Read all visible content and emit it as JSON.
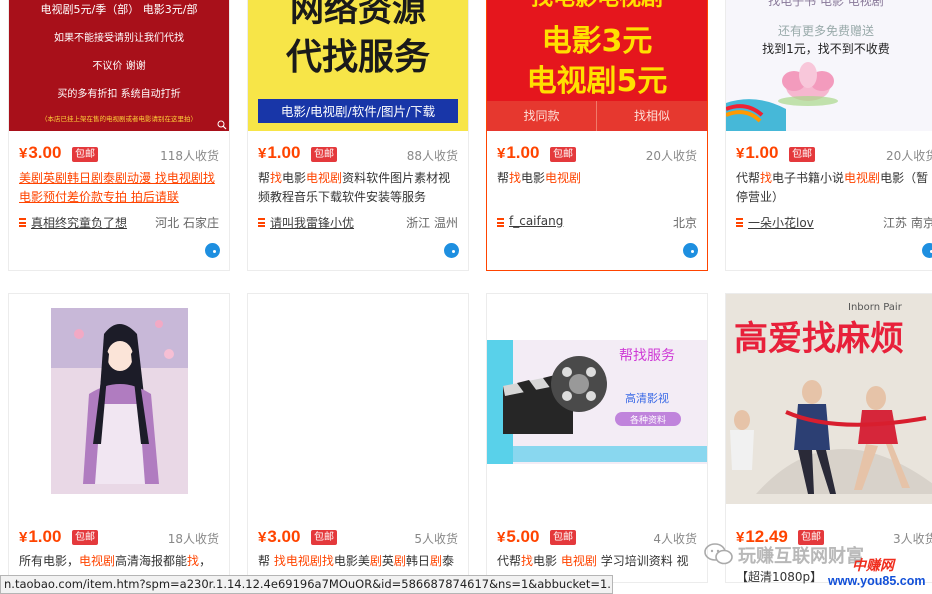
{
  "products": [
    {
      "price": "3.00",
      "tag": "包邮",
      "sold": "118人收货",
      "title": "美剧英剧韩日剧泰剧动漫 找电视剧找电影预付差价款专拍 拍后请联",
      "shop": "真相终究童负了想",
      "location": "河北 石家庄",
      "image": {
        "lines": [
          "电视剧5元/季（部） 电影3元/部",
          "如果不能接受请别让我们代找",
          "不议价 谢谢",
          "买的多有折扣 系统自动打折",
          "（本店已挂上架在售的电视剧或者电影请别在这里拍）"
        ]
      }
    },
    {
      "price": "1.00",
      "tag": "包邮",
      "sold": "88人收货",
      "title_segments": [
        {
          "t": "帮",
          "kw": false
        },
        {
          "t": "找",
          "kw": true
        },
        {
          "t": "电影",
          "kw": false
        },
        {
          "t": "电视剧",
          "kw": true
        },
        {
          "t": "资料软件图片素材视频教程音乐下载软件安装等服务",
          "kw": false
        }
      ],
      "shop": "请叫我雷锋小优",
      "location": "浙江 温州",
      "image": {
        "line1": "网络资源",
        "line2": "代找服务",
        "line3": "电影/电视剧/软件/图片/下载"
      }
    },
    {
      "price": "1.00",
      "tag": "包邮",
      "sold": "20人收货",
      "title_segments": [
        {
          "t": "帮",
          "kw": false
        },
        {
          "t": "找",
          "kw": true
        },
        {
          "t": "电影",
          "kw": false
        },
        {
          "t": "电视剧",
          "kw": true
        }
      ],
      "shop": "f_caifang",
      "location": "北京",
      "image": {
        "top": "找电影电视剧",
        "line1": "电影3元",
        "line2": "电视剧5元"
      },
      "buttons": [
        "找同款",
        "找相似"
      ]
    },
    {
      "price": "1.00",
      "tag": "包邮",
      "sold": "20人收货",
      "title_segments": [
        {
          "t": "代帮",
          "kw": false
        },
        {
          "t": "找",
          "kw": true
        },
        {
          "t": "电子书籍小说",
          "kw": false
        },
        {
          "t": "电视剧",
          "kw": true
        },
        {
          "t": "电影（暂停营业）",
          "kw": false
        }
      ],
      "shop": "一朵小花lov",
      "location": "江苏 南京",
      "image": {
        "top": "找电子书 电影 电视剧",
        "line1": "还有更多免费赠送",
        "line2": "找到1元，找不到不收费"
      }
    },
    {
      "price": "1.00",
      "tag": "包邮",
      "sold": "18人收货",
      "title_segments": [
        {
          "t": "所有电影，",
          "kw": false
        },
        {
          "t": "电视剧",
          "kw": true
        },
        {
          "t": "高清海报都能",
          "kw": false
        },
        {
          "t": "找",
          "kw": true
        },
        {
          "t": "，",
          "kw": false
        }
      ]
    },
    {
      "price": "3.00",
      "tag": "包邮",
      "sold": "5人收货",
      "title_segments": [
        {
          "t": "帮 ",
          "kw": false
        },
        {
          "t": "找电视剧",
          "kw": true
        },
        {
          "t": "找",
          "kw": true
        },
        {
          "t": "电影美",
          "kw": false
        },
        {
          "t": "剧",
          "kw": true
        },
        {
          "t": "英",
          "kw": false
        },
        {
          "t": "剧",
          "kw": true
        },
        {
          "t": "韩日",
          "kw": false
        },
        {
          "t": "剧",
          "kw": true
        },
        {
          "t": "泰",
          "kw": false
        }
      ]
    },
    {
      "price": "5.00",
      "tag": "包邮",
      "sold": "4人收货",
      "title_segments": [
        {
          "t": "代帮",
          "kw": false
        },
        {
          "t": "找",
          "kw": true
        },
        {
          "t": "电影 ",
          "kw": false
        },
        {
          "t": "电视剧",
          "kw": true
        },
        {
          "t": " 学习培训资料 视",
          "kw": false
        }
      ],
      "image": {
        "line1": "帮找服务",
        "line2": "高清影视",
        "line3": "各种资料"
      }
    },
    {
      "price": "12.49",
      "tag": "包邮",
      "sold": "3人收货",
      "title": "【超清1080p】",
      "image": {
        "title": "高爱找麻烦",
        "subtitle": "Inborn Pair"
      }
    }
  ],
  "status_url": "n.taobao.com/item.htm?spm=a230r.1.14.12.4e69196a7MOuOR&id=586687874617&ns=1&abbucket=1...",
  "watermark": {
    "text": "玩赚互联网财富",
    "logo_text": "中赚网",
    "url": "www.you85.com"
  },
  "colors": {
    "accent": "#ff4400",
    "tag_bg": "#e4393c",
    "wangwang": "#1e8fe0"
  }
}
